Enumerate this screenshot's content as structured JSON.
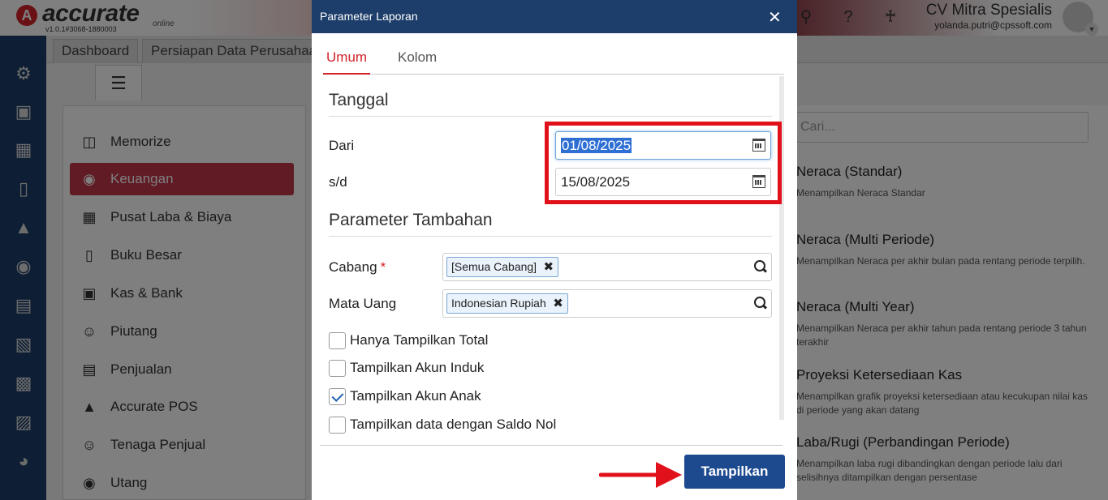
{
  "app": {
    "logo_text": "accurate",
    "logo_sub": "online",
    "version": "v1.0.1#3068-1880003",
    "company_name": "CV Mitra Spesialis",
    "user_email": "yolanda.putri@cpssoft.com"
  },
  "tabs": [
    "Dashboard",
    "Persiapan Data Perusahaan"
  ],
  "tab_count": "3",
  "menu": [
    {
      "label": "Memorize",
      "icon": "save-icon"
    },
    {
      "label": "Keuangan",
      "icon": "money-bag-icon",
      "active": true
    },
    {
      "label": "Pusat Laba & Biaya",
      "icon": "qr-icon"
    },
    {
      "label": "Buku Besar",
      "icon": "ledger-icon"
    },
    {
      "label": "Kas & Bank",
      "icon": "cash-icon"
    },
    {
      "label": "Piutang",
      "icon": "receivable-icon"
    },
    {
      "label": "Penjualan",
      "icon": "cart-icon"
    },
    {
      "label": "Accurate POS",
      "icon": "pos-icon"
    },
    {
      "label": "Tenaga Penjual",
      "icon": "salesperson-icon"
    },
    {
      "label": "Utang",
      "icon": "payable-icon"
    }
  ],
  "reports": {
    "search_placeholder": "Cari...",
    "items": [
      {
        "title": "Neraca (Standar)",
        "desc": "Menampilkan Neraca Standar"
      },
      {
        "title": "Neraca (Multi Periode)",
        "desc": "Menampilkan Neraca per akhir bulan pada rentang periode terpilih."
      },
      {
        "title": "Neraca (Multi Year)",
        "desc": "Menampilkan Neraca per akhir tahun pada rentang periode 3 tahun terakhir"
      },
      {
        "title": "Proyeksi Ketersediaan Kas",
        "desc": "Menampilkan grafik proyeksi ketersediaan atau kecukupan nilai kas di periode yang akan datang"
      },
      {
        "title": "Laba/Rugi (Perbandingan Periode)",
        "desc": "Menampilkan laba rugi dibandingkan dengan periode lalu dari selisihnya ditampilkan dengan persentase"
      }
    ]
  },
  "modal": {
    "title": "Parameter Laporan",
    "tabs": [
      "Umum",
      "Kolom"
    ],
    "section_tanggal": "Tanggal",
    "label_dari": "Dari",
    "value_dari": "01/08/2025",
    "label_sd": "s/d",
    "value_sd": "15/08/2025",
    "section_tambahan": "Parameter Tambahan",
    "label_cabang": "Cabang",
    "required_mark": "*",
    "tag_cabang": "[Semua Cabang]",
    "label_mata_uang": "Mata Uang",
    "tag_mata_uang": "Indonesian Rupiah",
    "checks": [
      {
        "label": "Hanya Tampilkan Total",
        "checked": false
      },
      {
        "label": "Tampilkan Akun Induk",
        "checked": false
      },
      {
        "label": "Tampilkan Akun Anak",
        "checked": true
      },
      {
        "label": "Tampilkan data dengan Saldo Nol",
        "checked": false
      }
    ],
    "button_label": "Tampilkan"
  },
  "colors": {
    "primary_navy": "#1d3d6a",
    "button_blue": "#1d4a8f",
    "accent_red": "#d2232a",
    "highlight_red": "#e0111b"
  }
}
